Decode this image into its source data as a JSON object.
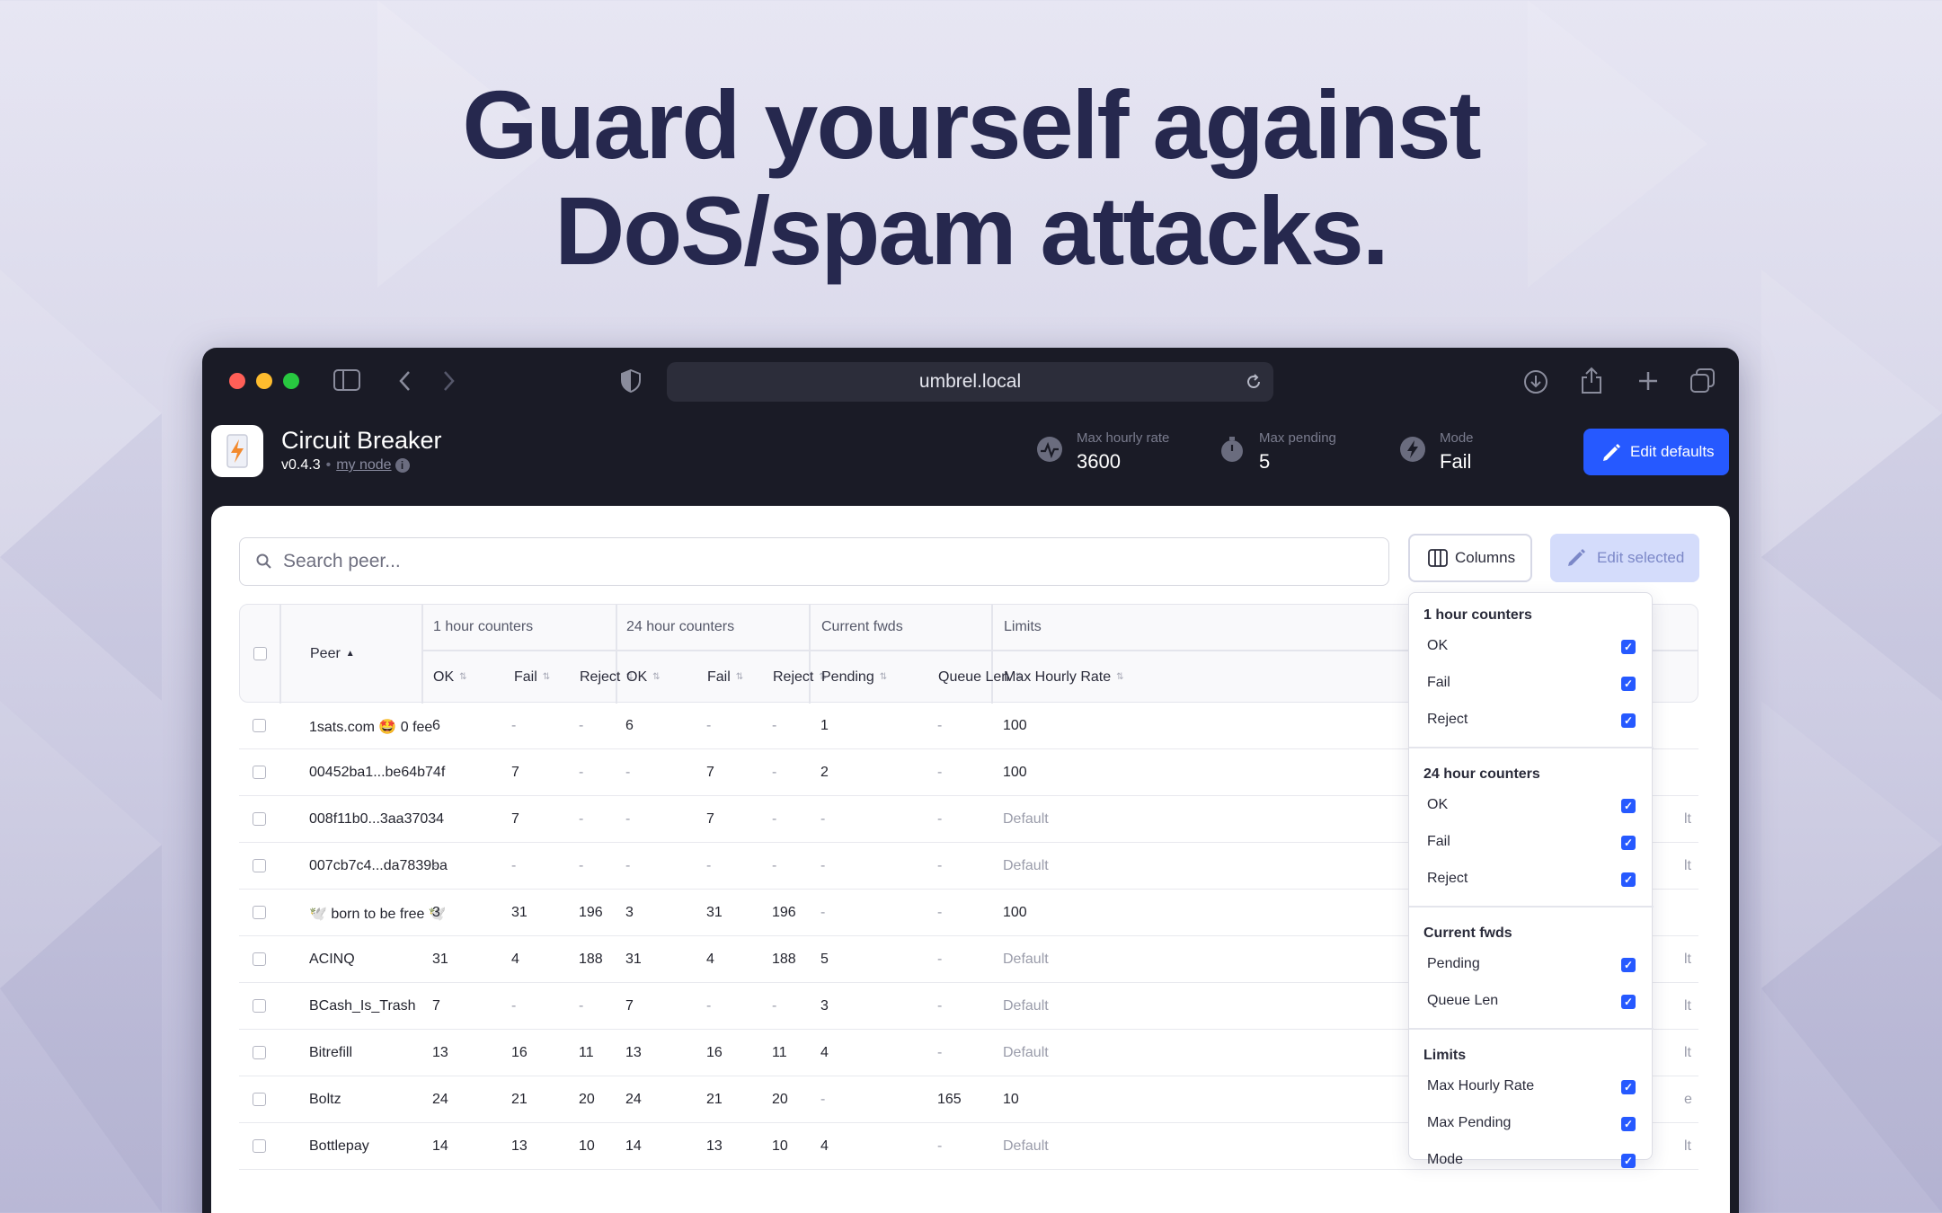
{
  "headline": {
    "line1": "Guard yourself against",
    "line2": "DoS/spam attacks."
  },
  "browser": {
    "url": "umbrel.local"
  },
  "app": {
    "name": "Circuit Breaker",
    "version": "v0.4.3",
    "separator": "•",
    "node_label": "my node",
    "info_glyph": "i",
    "stats": [
      {
        "label": "Max hourly rate",
        "value": "3600",
        "icon": "gauge-icon"
      },
      {
        "label": "Max pending",
        "value": "5",
        "icon": "stopwatch-icon"
      },
      {
        "label": "Mode",
        "value": "Fail",
        "icon": "bolt-icon"
      }
    ],
    "edit_defaults_label": "Edit defaults"
  },
  "toolbar": {
    "search_placeholder": "Search peer...",
    "columns_label": "Columns",
    "edit_selected_label": "Edit selected"
  },
  "table": {
    "peer_header": "Peer",
    "groups": [
      "1 hour counters",
      "24 hour counters",
      "Current fwds",
      "Limits"
    ],
    "subheaders": [
      "OK",
      "Fail",
      "Reject",
      "OK",
      "Fail",
      "Reject",
      "Pending",
      "Queue Len",
      "Max Hourly Rate"
    ],
    "rows": [
      {
        "peer": "1sats.com 🤩 0 fee",
        "cells": [
          "6",
          "-",
          "-",
          "6",
          "-",
          "-",
          "1",
          "-",
          "100"
        ],
        "edge": ""
      },
      {
        "peer": "00452ba1...be64b74f",
        "cells": [
          "-",
          "7",
          "-",
          "-",
          "7",
          "-",
          "2",
          "-",
          "100"
        ],
        "edge": ""
      },
      {
        "peer": "008f11b0...3aa37034",
        "cells": [
          "-",
          "7",
          "-",
          "-",
          "7",
          "-",
          "-",
          "-",
          "Default"
        ],
        "edge": "lt"
      },
      {
        "peer": "007cb7c4...da7839ba",
        "cells": [
          "-",
          "-",
          "-",
          "-",
          "-",
          "-",
          "-",
          "-",
          "Default"
        ],
        "edge": "lt"
      },
      {
        "peer": "🕊️ born to be free 🕊️",
        "cells": [
          "3",
          "31",
          "196",
          "3",
          "31",
          "196",
          "-",
          "-",
          "100"
        ],
        "edge": ""
      },
      {
        "peer": "ACINQ",
        "cells": [
          "31",
          "4",
          "188",
          "31",
          "4",
          "188",
          "5",
          "-",
          "Default"
        ],
        "edge": "lt"
      },
      {
        "peer": "BCash_Is_Trash",
        "cells": [
          "7",
          "-",
          "-",
          "7",
          "-",
          "-",
          "3",
          "-",
          "Default"
        ],
        "edge": "lt"
      },
      {
        "peer": "Bitrefill",
        "cells": [
          "13",
          "16",
          "11",
          "13",
          "16",
          "11",
          "4",
          "-",
          "Default"
        ],
        "edge": "lt"
      },
      {
        "peer": "Boltz",
        "cells": [
          "24",
          "21",
          "20",
          "24",
          "21",
          "20",
          "-",
          "165",
          "10"
        ],
        "edge": "e"
      },
      {
        "peer": "Bottlepay",
        "cells": [
          "14",
          "13",
          "10",
          "14",
          "13",
          "10",
          "4",
          "-",
          "Default"
        ],
        "edge": "lt"
      }
    ]
  },
  "columns_menu": {
    "check_glyph": "✓",
    "groups": [
      {
        "title": "1 hour counters",
        "items": [
          "OK",
          "Fail",
          "Reject"
        ]
      },
      {
        "title": "24 hour counters",
        "items": [
          "OK",
          "Fail",
          "Reject"
        ]
      },
      {
        "title": "Current fwds",
        "items": [
          "Pending",
          "Queue Len"
        ]
      },
      {
        "title": "Limits",
        "items": [
          "Max Hourly Rate",
          "Max Pending",
          "Mode"
        ]
      }
    ]
  },
  "colors": {
    "accent": "#2659ff",
    "headline": "#26284e",
    "dark_bg": "#1a1b26"
  }
}
